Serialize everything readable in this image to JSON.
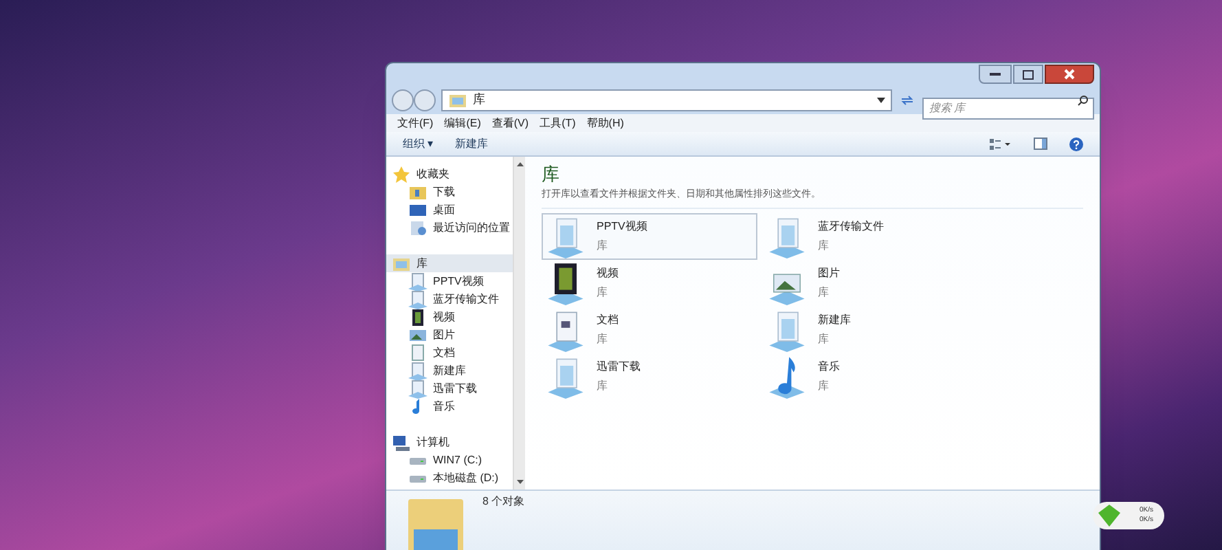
{
  "address_bar": {
    "path": [
      "库"
    ],
    "search_placeholder": "搜索 库"
  },
  "menu": [
    "文件(F)",
    "编辑(E)",
    "查看(V)",
    "工具(T)",
    "帮助(H)"
  ],
  "toolbar": {
    "organize": "组织 ▾",
    "new_library": "新建库"
  },
  "sidebar": {
    "groups": [
      {
        "label": "收藏夹",
        "kind": "star",
        "selected": false,
        "children": [
          {
            "label": "下载",
            "kind": "download"
          },
          {
            "label": "桌面",
            "kind": "desktop"
          },
          {
            "label": "最近访问的位置",
            "kind": "recent"
          }
        ]
      },
      {
        "label": "库",
        "kind": "library",
        "selected": true,
        "children": [
          {
            "label": "PPTV视频",
            "kind": "lib"
          },
          {
            "label": "蓝牙传输文件",
            "kind": "lib"
          },
          {
            "label": "视频",
            "kind": "video"
          },
          {
            "label": "图片",
            "kind": "picture"
          },
          {
            "label": "文档",
            "kind": "doc"
          },
          {
            "label": "新建库",
            "kind": "lib"
          },
          {
            "label": "迅雷下载",
            "kind": "lib"
          },
          {
            "label": "音乐",
            "kind": "music"
          }
        ]
      },
      {
        "label": "计算机",
        "kind": "computer",
        "selected": false,
        "children": [
          {
            "label": "WIN7 (C:)",
            "kind": "drive"
          },
          {
            "label": "本地磁盘 (D:)",
            "kind": "drive"
          }
        ]
      }
    ]
  },
  "content": {
    "title": "库",
    "description": "打开库以查看文件并根据文件夹、日期和其他属性排列这些文件。",
    "items": [
      {
        "name": "PPTV视频",
        "type": "库",
        "kind": "lib",
        "selected": true
      },
      {
        "name": "蓝牙传输文件",
        "type": "库",
        "kind": "lib",
        "selected": false
      },
      {
        "name": "视频",
        "type": "库",
        "kind": "video",
        "selected": false
      },
      {
        "name": "图片",
        "type": "库",
        "kind": "picture",
        "selected": false
      },
      {
        "name": "文档",
        "type": "库",
        "kind": "doc",
        "selected": false
      },
      {
        "name": "新建库",
        "type": "库",
        "kind": "lib",
        "selected": false
      },
      {
        "name": "迅雷下载",
        "type": "库",
        "kind": "lib",
        "selected": false
      },
      {
        "name": "音乐",
        "type": "库",
        "kind": "music",
        "selected": false
      }
    ]
  },
  "details": {
    "count": "8 个对象"
  },
  "speed_widget": {
    "upload": "0K/s",
    "download": "0K/s"
  }
}
